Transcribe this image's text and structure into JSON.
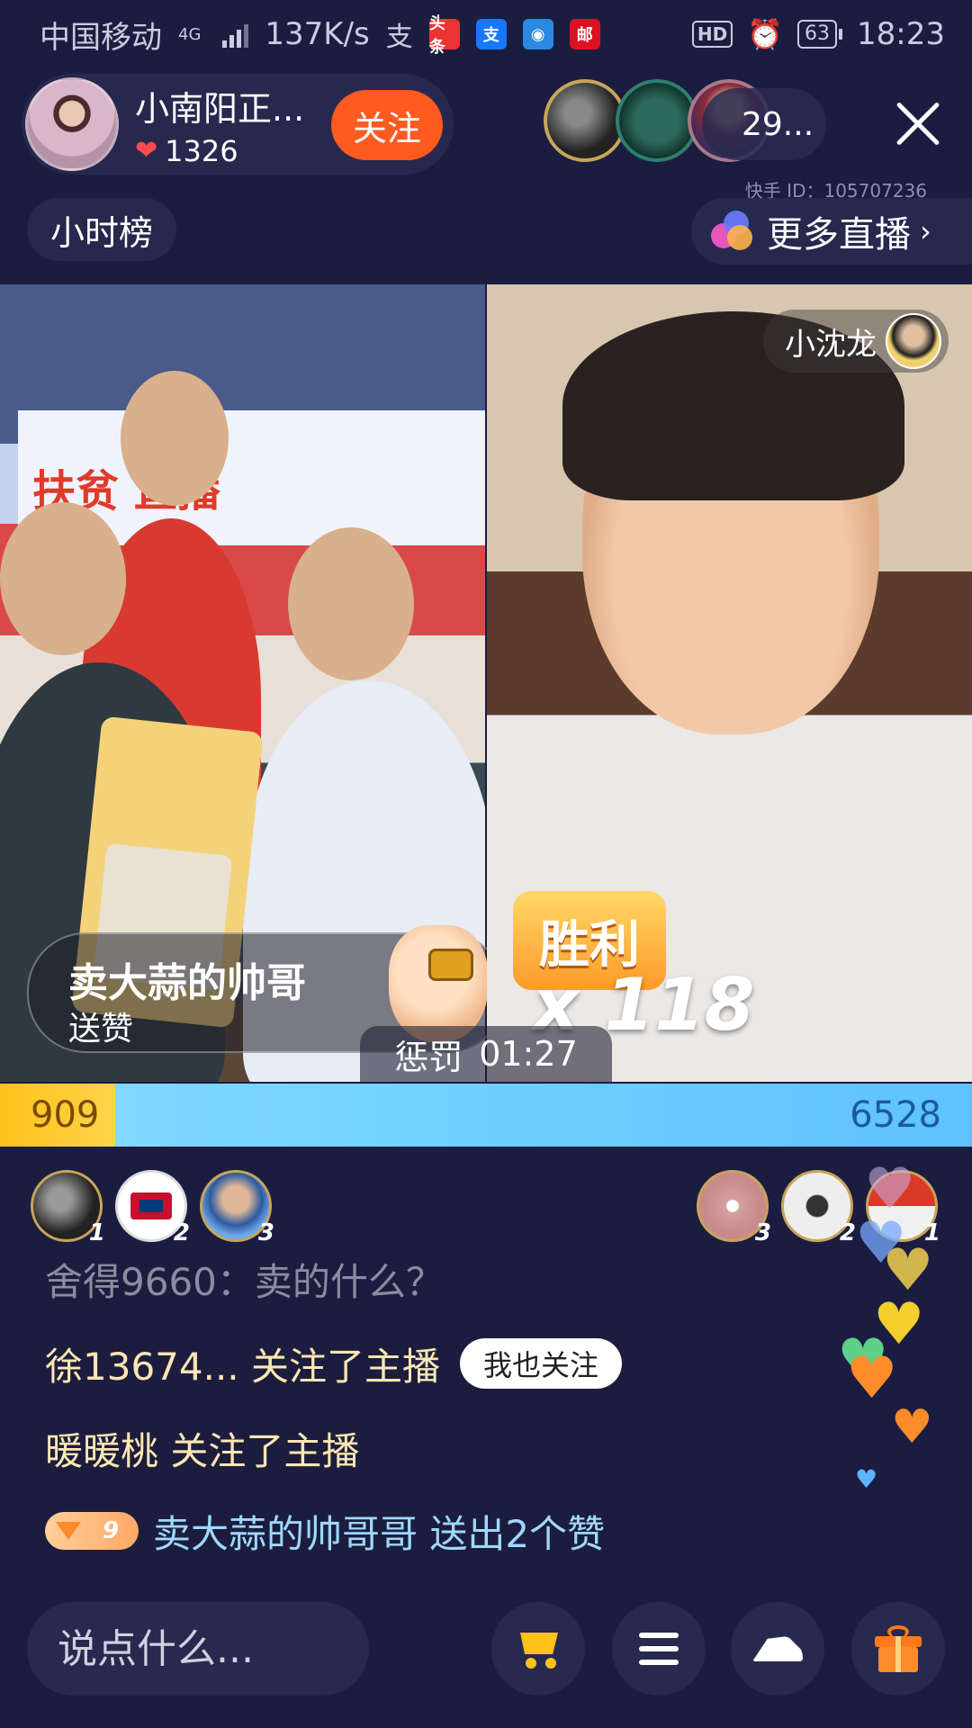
{
  "status_bar": {
    "carrier": "中国移动",
    "network": "4G",
    "speed": "137K/s",
    "apps": [
      "头条",
      "支",
      "邮"
    ],
    "hd": "HD",
    "battery": "63",
    "time": "18:23"
  },
  "anchor": {
    "name": "小南阳正...",
    "likes": "1326",
    "follow_label": "关注"
  },
  "viewers": {
    "count": "29..."
  },
  "kuaishou_id": "快手 ID：105707236",
  "hour_rank_label": "小时榜",
  "more_live_label": "更多直播",
  "left_stream": {
    "gift_title": "卖大蒜的帅哥",
    "gift_sub": "送赞",
    "banner": "扶贫 直播"
  },
  "right_stream": {
    "streamer_name": "小沈龙",
    "victory_label": "胜利",
    "multiplier": "x 118"
  },
  "penalty": {
    "label": "惩罚",
    "time": "01:27"
  },
  "pk": {
    "left_score": "909",
    "right_score": "6528"
  },
  "left_contributors": [
    {
      "rank": "1"
    },
    {
      "rank": "2"
    },
    {
      "rank": "3"
    }
  ],
  "right_contributors": [
    {
      "rank": "3"
    },
    {
      "rank": "2"
    },
    {
      "rank": "1"
    }
  ],
  "chat": [
    {
      "text": "舍得9660：卖的什么？"
    },
    {
      "text": "徐13674... 关注了主播",
      "action": "我也关注"
    },
    {
      "text": "暖暖桃 关注了主播"
    },
    {
      "level": "9",
      "text": "卖大蒜的帅哥哥  送出2个赞"
    }
  ],
  "input": {
    "placeholder": "说点什么..."
  },
  "colors": {
    "background": "#1b1d40",
    "follow": "#ff5a1f",
    "pk_left": "#ffc21a",
    "pk_right": "#5fc2ff"
  }
}
